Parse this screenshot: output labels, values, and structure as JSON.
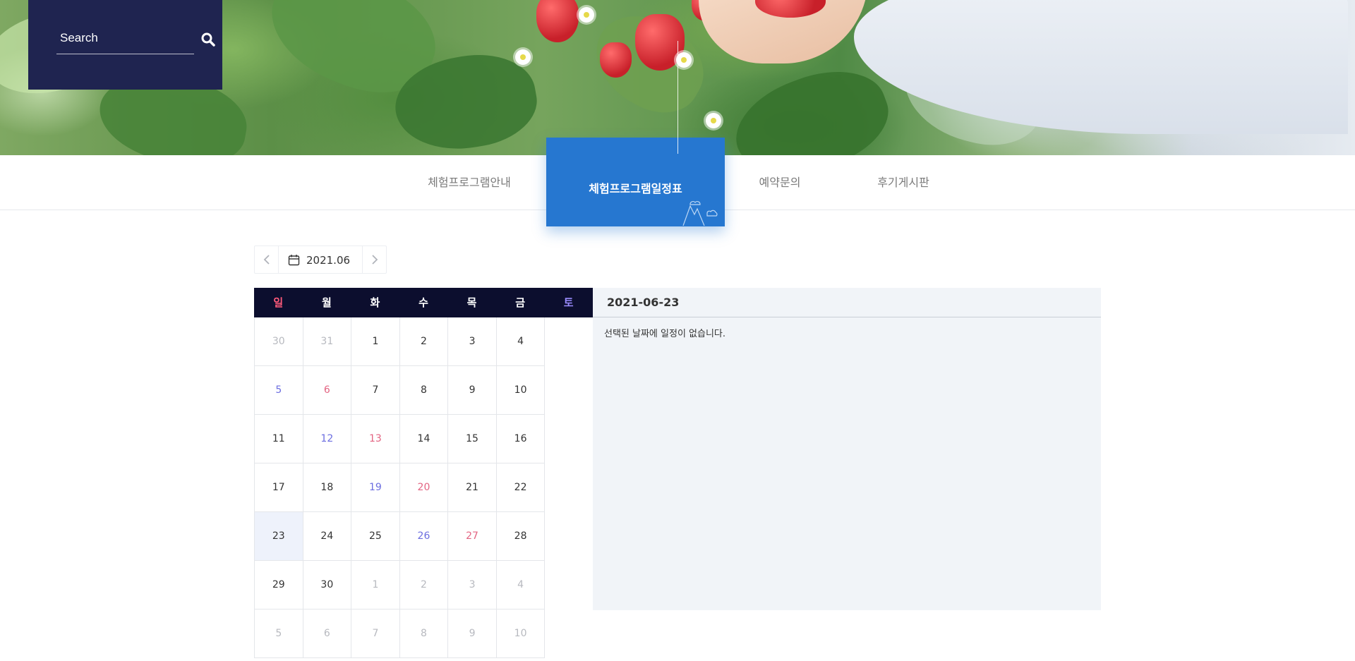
{
  "search": {
    "label": "Search"
  },
  "tabs": [
    {
      "label": "체험프로그램안내",
      "active": false
    },
    {
      "label": "체험프로그램일정표",
      "active": true
    },
    {
      "label": "예약문의",
      "active": false
    },
    {
      "label": "후기게시판",
      "active": false
    }
  ],
  "month_nav": {
    "label": "2021.06"
  },
  "calendar": {
    "weekdays": [
      "일",
      "월",
      "화",
      "수",
      "목",
      "금",
      "토"
    ],
    "weekday_colors": {
      "sun": "#ff5a7a",
      "sat": "#9a8cff"
    },
    "days": [
      [
        "30",
        "31",
        "1",
        "2",
        "3",
        "4",
        "5"
      ],
      [
        "6",
        "7",
        "8",
        "9",
        "10",
        "11",
        "12"
      ],
      [
        "13",
        "14",
        "15",
        "16",
        "17",
        "18",
        "19"
      ],
      [
        "20",
        "21",
        "22",
        "23",
        "24",
        "25",
        "26"
      ],
      [
        "27",
        "28",
        "29",
        "30",
        "1",
        "2",
        "3"
      ],
      [
        "4",
        "5",
        "6",
        "7",
        "8",
        "9",
        "10"
      ]
    ],
    "selected": "23"
  },
  "schedule": {
    "date": "2021-06-23",
    "empty_message": "선택된 날짜에 일정이 없습니다."
  },
  "colors": {
    "accent": "#2677d0",
    "navy": "#1f2450",
    "header_dark": "#0c0e2e"
  }
}
